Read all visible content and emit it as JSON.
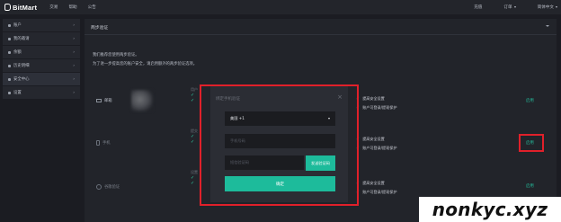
{
  "app": {
    "brand": "BitMart"
  },
  "topnav": {
    "items": [
      "交易",
      "帮助",
      "公告"
    ]
  },
  "topright": {
    "assets": "充值",
    "orders": "订单",
    "language": "简体中文"
  },
  "sidebar": {
    "items": [
      {
        "label": "账户"
      },
      {
        "label": "我的邀请"
      },
      {
        "label": "余额"
      },
      {
        "label": "历史明细"
      },
      {
        "label": "安全中心"
      },
      {
        "label": "设置"
      }
    ]
  },
  "panel": {
    "title": "两步验证",
    "intro_line1": "我们推荐您使用两步验证。",
    "intro_line2": "为了进一步提高您的账户安全，请启用额外的两步验证选项。"
  },
  "security_rows": [
    {
      "label": "邮箱",
      "check1": "提高安全设置",
      "check2": "账户可登录/提现保护",
      "action": "启用"
    },
    {
      "label": "手机",
      "check1": "提高安全设置",
      "check2": "账户可登录/提现保护",
      "action": "启用"
    },
    {
      "label": "谷歌验证",
      "check1": "提高安全设置",
      "check2": "账户可登录/提现保护",
      "action": "启用"
    }
  ],
  "strips": {
    "row1": "用户",
    "row2": "提交",
    "row3": "设置"
  },
  "modal": {
    "title": "绑定手机验证",
    "close": "×",
    "country_value": "美国 +1",
    "phone_placeholder": "手机号码",
    "code_placeholder": "短信验证码",
    "send_button": "发送验证码",
    "confirm_button": "确定"
  },
  "watermark": {
    "text": "nonkyc.xyz"
  },
  "colors": {
    "accent": "#1dbb9b",
    "highlight": "#e0202a",
    "background": "#1b1c22"
  }
}
